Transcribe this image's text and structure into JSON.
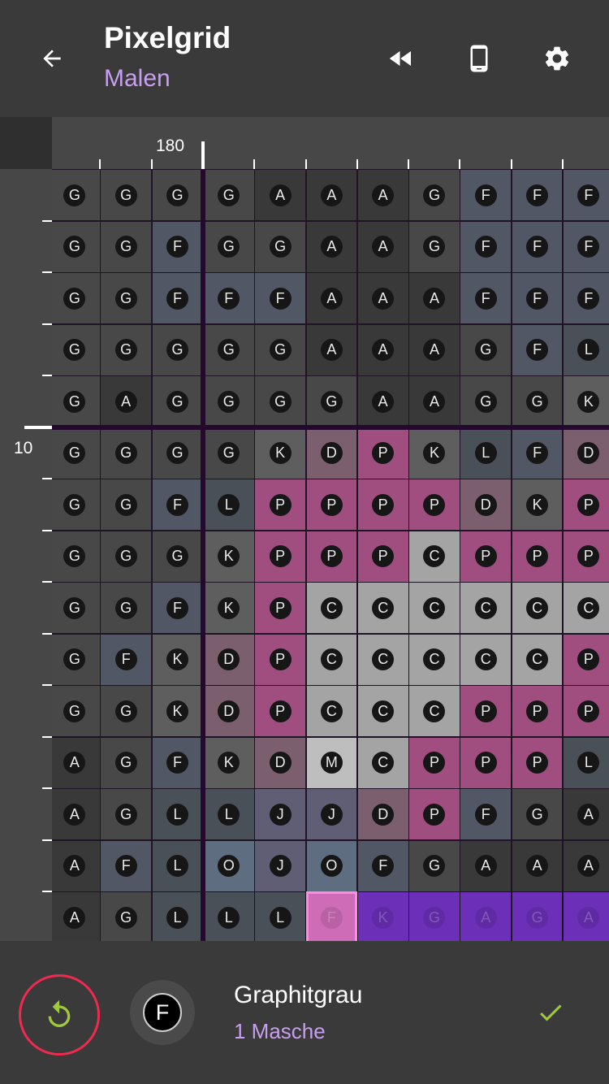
{
  "app": {
    "title": "Pixelgrid",
    "subtitle": "Malen"
  },
  "icons": {
    "back": "arrow-left-icon",
    "rewind": "rewind-icon",
    "phone": "phone-icon",
    "settings": "gear-icon",
    "undo": "undo-icon",
    "confirm": "check-icon"
  },
  "ruler": {
    "column_label": "180",
    "row_label": "10"
  },
  "colors": {
    "G": "#484848",
    "A": "#393939",
    "F": "#525766",
    "K": "#5e5e5e",
    "L": "#4a5058",
    "D": "#7c5f6e",
    "P": "#9f4e7f",
    "C": "#a4a4a4",
    "M": "#bebebe",
    "J": "#5f5e75",
    "O": "#5e6e80",
    "selection": "#6b2fb8",
    "highlight_border": "#ff8ce0",
    "accent_purple": "#c89ef0",
    "undo_ring": "#f0294e",
    "undo_icon": "#a0c83c",
    "confirm_icon": "#a0c83c"
  },
  "grid": {
    "rows": [
      "GGGGAAAGFFF",
      "GGFGGAAGFFF",
      "GGFFFAAAFFF",
      "GGGGGAAAGFL",
      "GAGGGGAAGGK",
      "GGGGKDPKLFD",
      "GGFLPPPPDKP",
      "GGGKPPPCPPP",
      "GGFKPCCCCCC",
      "GFKDPCCCCCP",
      "GGKDPCCCPPP",
      "AGFKDMCPPPL",
      "AGLLJJDPFGA",
      "AFLOJOFGAAA",
      "AGLLLFKGAGA"
    ],
    "highlight": {
      "row": 14,
      "col": 5
    },
    "selection": {
      "row": 14,
      "from_col": 6,
      "to_col": 10
    }
  },
  "bottom": {
    "symbol": "F",
    "color_name": "Graphitgrau",
    "stitch_count": "1 Masche"
  }
}
